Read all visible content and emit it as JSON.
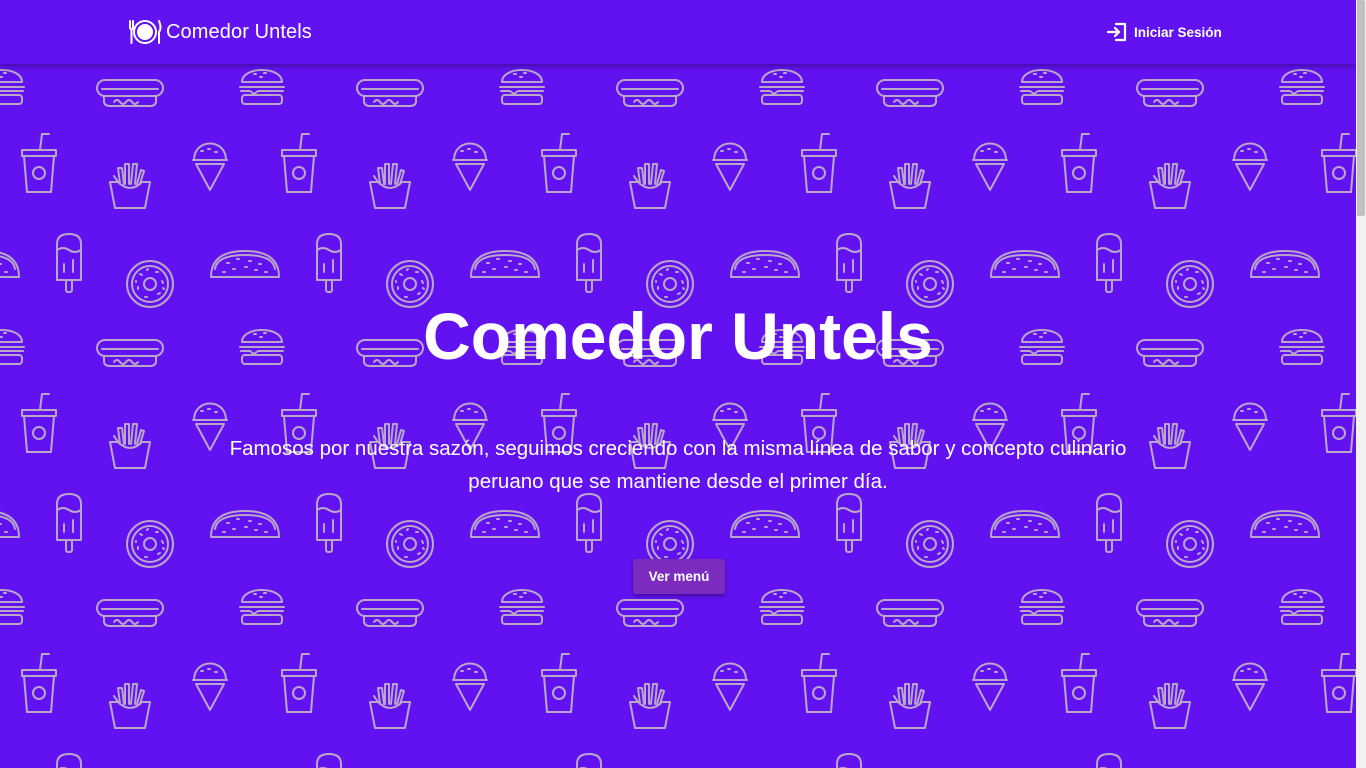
{
  "header": {
    "brand": "Comedor Untels",
    "brand_icon": "plate-cutlery-icon",
    "login_label": "Iniciar Sesión",
    "login_icon": "login-icon"
  },
  "hero": {
    "title": "Comedor Untels",
    "description": "Famosos por nuestra sazón, seguimos creciendo con la misma línea de sabor y concepto culinario peruano que se mantiene desde el primer día.",
    "cta_label": "Ver menú"
  },
  "colors": {
    "background": "#6212F0",
    "pattern_stroke": "#B9A7C9",
    "button": "#7B2CBF",
    "text": "#FFFFFF"
  },
  "background_pattern_icons": [
    "burger-icon",
    "hotdog-icon",
    "soda-cup-icon",
    "fries-icon",
    "ice-cream-cone-icon",
    "popsicle-icon",
    "donut-icon",
    "taco-icon"
  ]
}
